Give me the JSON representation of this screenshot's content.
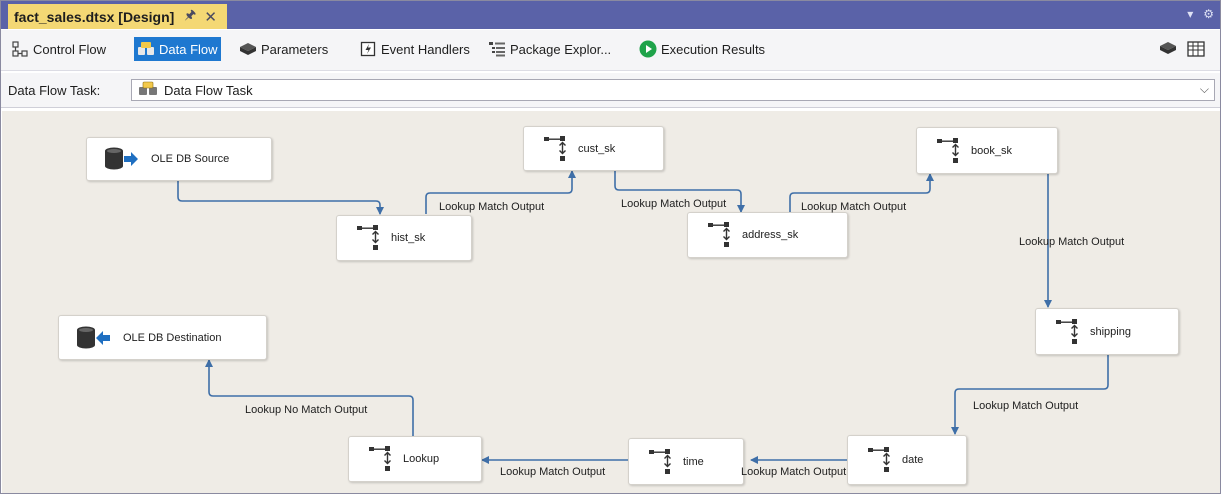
{
  "document_tab": {
    "title": "fact_sales.dtsx [Design]",
    "pin_icon": "pin-icon",
    "close_icon": "close-icon"
  },
  "toolbar": {
    "tabs": [
      {
        "label": "Control Flow",
        "icon": "control-flow-icon",
        "active": false
      },
      {
        "label": "Data Flow",
        "icon": "data-flow-icon",
        "active": true
      },
      {
        "label": "Parameters",
        "icon": "parameters-icon",
        "active": false
      },
      {
        "label": "Event Handlers",
        "icon": "event-handlers-icon",
        "active": false
      },
      {
        "label": "Package Explor...",
        "icon": "package-explorer-icon",
        "active": false
      },
      {
        "label": "Execution Results",
        "icon": "execution-results-icon",
        "active": false
      }
    ]
  },
  "task_selector": {
    "label": "Data Flow Task:",
    "value": "Data Flow Task"
  },
  "components": {
    "ole_db_source": "OLE DB Source",
    "hist_sk": "hist_sk",
    "cust_sk": "cust_sk",
    "address_sk": "address_sk",
    "book_sk": "book_sk",
    "shipping": "shipping",
    "date": "date",
    "time": "time",
    "lookup": "Lookup",
    "ole_db_destination": "OLE DB Destination"
  },
  "path_labels": {
    "hist_to_cust": "Lookup Match Output",
    "cust_to_address": "Lookup Match Output",
    "address_to_book": "Lookup Match Output",
    "book_to_shipping": "Lookup Match Output",
    "shipping_to_date": "Lookup Match Output",
    "date_to_time": "Lookup Match Output",
    "time_to_lookup": "Lookup Match Output",
    "lookup_to_destination": "Lookup No Match Output"
  },
  "colors": {
    "title_bar": "#5a62a8",
    "document_tab": "#f4d874",
    "active_tab": "#1e78d0",
    "canvas": "#efece6",
    "path": "#3f6fa8"
  }
}
